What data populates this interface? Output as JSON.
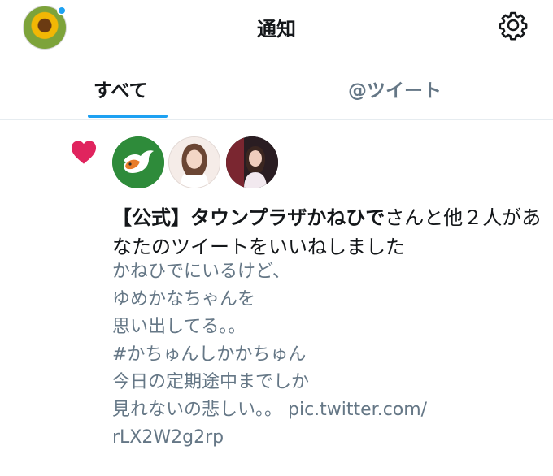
{
  "header": {
    "title": "通知"
  },
  "tabs": [
    {
      "label": "すべて",
      "selected": true
    },
    {
      "label": "@ツイート",
      "selected": false
    }
  ],
  "notification": {
    "type": "like",
    "actor_name": "【公式】タウンプラザかねひで",
    "action_text": "さんと他２人があなたのツイートをいいねしました",
    "tweet_lines": [
      "かねひでにいるけど、",
      "ゆめかなちゃんを",
      "思い出してる。。",
      "#かちゅんしかかちゅん",
      "今日の定期途中までしか",
      "見れないの悲しい。。 pic.twitter.com/",
      "rLX2W2g2rp"
    ]
  },
  "colors": {
    "accent": "#1da1f2",
    "like": "#e0245e",
    "secondary_text": "#657786"
  }
}
